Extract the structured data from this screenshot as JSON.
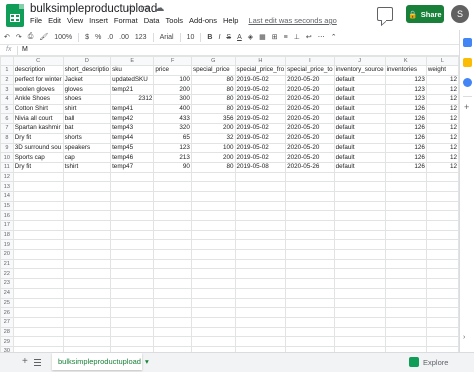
{
  "app": {
    "doc_title": "bulksimpleproductupload",
    "menu": [
      "File",
      "Edit",
      "View",
      "Insert",
      "Format",
      "Data",
      "Tools",
      "Add-ons",
      "Help"
    ],
    "last_edit": "Last edit was seconds ago",
    "share_label": "Share",
    "avatar_letter": "S",
    "share_color": "#188038"
  },
  "toolbar": {
    "zoom": "100%",
    "currency": "$",
    "percent": "%",
    "dec_less": ".0",
    "dec_more": ".00",
    "number_format": "123",
    "font": "Arial",
    "font_size": "10",
    "bold": "B",
    "italic": "I",
    "strike": "S",
    "text_color": "A"
  },
  "formula_bar": {
    "fx": "fx",
    "value": "M"
  },
  "grid": {
    "columns": [
      "C",
      "D",
      "E",
      "F",
      "G",
      "H",
      "I",
      "J",
      "K",
      "L"
    ],
    "row_numbers": [
      "1",
      "2",
      "3",
      "4",
      "5",
      "6",
      "7",
      "8",
      "9",
      "10",
      "11",
      "12",
      "13",
      "14",
      "15",
      "16",
      "17",
      "18",
      "19",
      "20",
      "21",
      "22",
      "23",
      "24",
      "25",
      "26",
      "27",
      "28",
      "29",
      "30"
    ],
    "rows": [
      [
        "description",
        "short_descriptio",
        "sku",
        "price",
        "special_price",
        "special_price_fro",
        "special_price_to",
        "inventory_source",
        "inventories",
        "weight"
      ],
      [
        "perfect for winter",
        "Jacket",
        "updatedSKU",
        "100",
        "80",
        "2019-05-02",
        "2020-05-20",
        "default",
        "123",
        "12"
      ],
      [
        "woolen gloves",
        "gloves",
        "temp21",
        "200",
        "80",
        "2019-05-02",
        "2020-05-20",
        "default",
        "123",
        "12"
      ],
      [
        "Ankle Shoes",
        "shoes",
        "2312",
        "300",
        "80",
        "2019-05-02",
        "2020-05-20",
        "default",
        "123",
        "12"
      ],
      [
        "Cotton Shirt",
        "shirt",
        "temp41",
        "400",
        "80",
        "2019-05-02",
        "2020-05-20",
        "default",
        "126",
        "12"
      ],
      [
        "Nivia all court",
        "ball",
        "temp42",
        "433",
        "356",
        "2019-05-02",
        "2020-05-20",
        "default",
        "126",
        "12"
      ],
      [
        "Spartan kashmir",
        "bat",
        "temp43",
        "320",
        "200",
        "2019-05-02",
        "2020-05-20",
        "default",
        "126",
        "12"
      ],
      [
        "Dry fit",
        "shorts",
        "temp44",
        "65",
        "32",
        "2019-05-02",
        "2020-05-20",
        "default",
        "126",
        "12"
      ],
      [
        "3D surround sou",
        "speakers",
        "temp45",
        "123",
        "100",
        "2019-05-02",
        "2020-05-20",
        "default",
        "126",
        "12"
      ],
      [
        "Sports cap",
        "cap",
        "temp46",
        "213",
        "200",
        "2019-05-02",
        "2020-05-20",
        "default",
        "126",
        "12"
      ],
      [
        "Dry fit",
        "tshirt",
        "temp47",
        "90",
        "80",
        "2019-05-08",
        "2020-05-26",
        "default",
        "126",
        "12"
      ]
    ]
  },
  "bottom": {
    "add_sheet": "+",
    "sheet_tab": "bulksimpleproductupload",
    "explore": "Explore"
  }
}
